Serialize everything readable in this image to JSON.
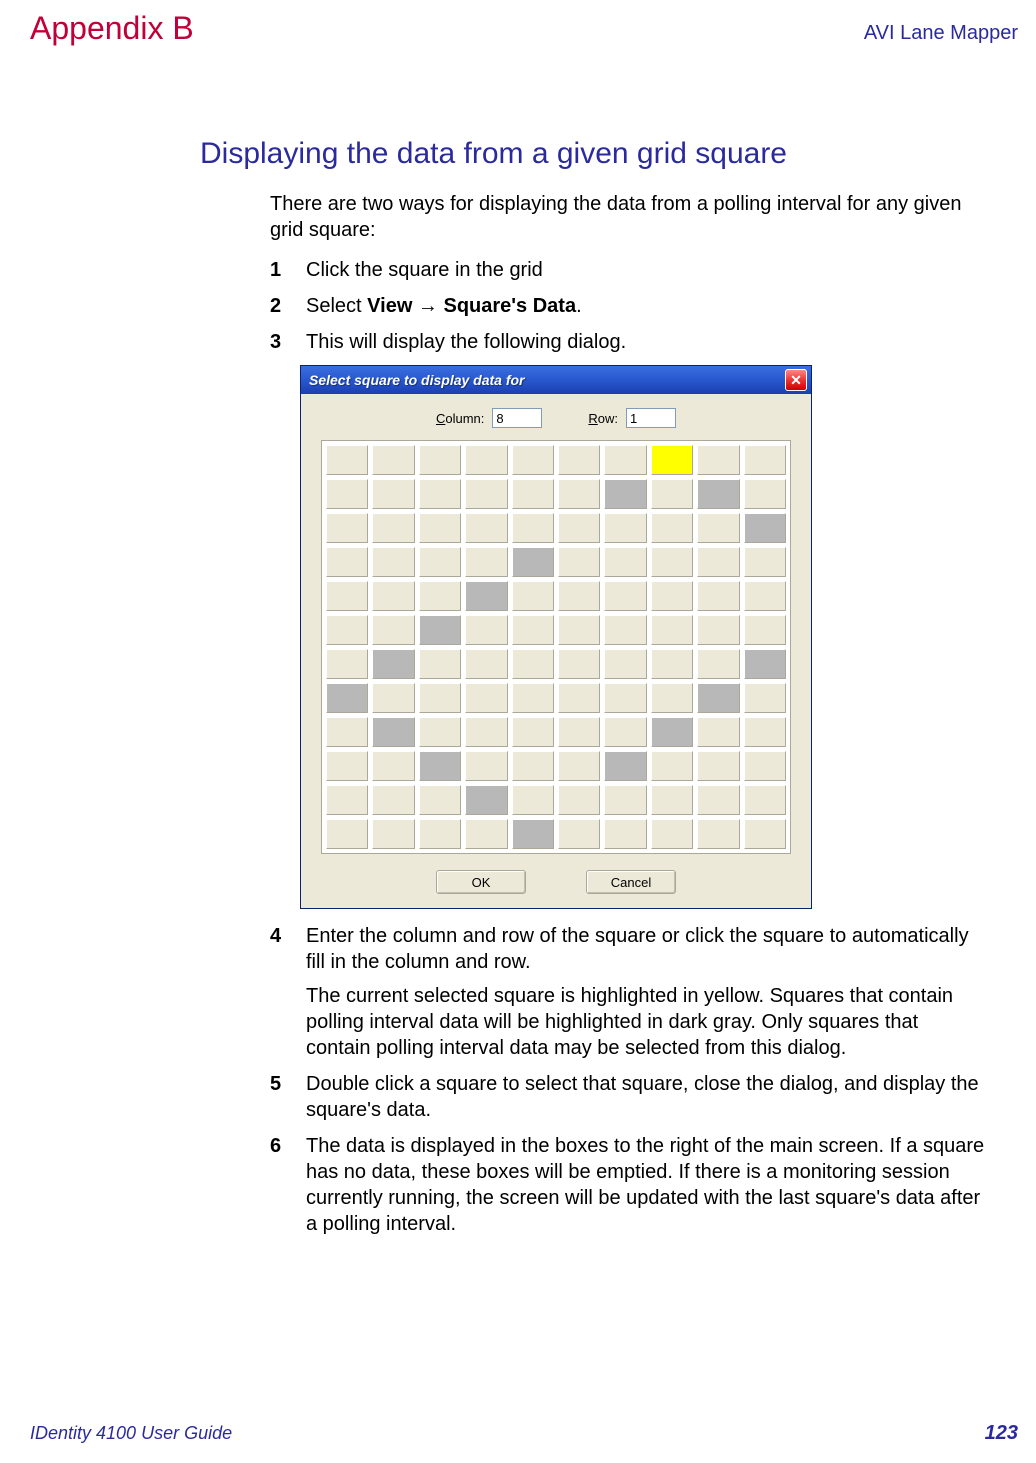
{
  "header": {
    "appendix": "Appendix B",
    "right": "AVI Lane Mapper"
  },
  "section": {
    "heading": "Displaying the data from a given grid square",
    "intro": "There are two ways for displaying the data from a polling interval for any given grid square:"
  },
  "steps": {
    "s1": "Click the square in the grid",
    "s2_pre": "Select ",
    "s2_bold": "View → Square's Data",
    "s2_post": ".",
    "s3": "This will display the following dialog.",
    "s4a": "Enter the column and row of the square or click the square to automatically fill in the column and row.",
    "s4b": "The current selected square is highlighted in yellow. Squares that contain polling interval data will be highlighted in dark gray. Only squares that contain polling interval data may be selected from this dialog.",
    "s5": "Double click a square to select that square, close the dialog, and display the square's data.",
    "s6": "The data is displayed in the boxes to the right of the main screen. If a square has no data, these boxes will be emptied. If there is a monitoring session currently running, the screen will be updated with the last square's data after a polling interval."
  },
  "dialog": {
    "title": "Select square to display data for",
    "column_label_u": "C",
    "column_label_rest": "olumn:",
    "row_label_u": "R",
    "row_label_rest": "ow:",
    "column_value": "8",
    "row_value": "1",
    "ok": "OK",
    "cancel": "Cancel",
    "grid": {
      "rows": 12,
      "cols": 10,
      "selected": [
        0,
        7
      ],
      "data_cells": [
        [
          1,
          6
        ],
        [
          1,
          8
        ],
        [
          2,
          9
        ],
        [
          3,
          4
        ],
        [
          4,
          3
        ],
        [
          5,
          2
        ],
        [
          6,
          1
        ],
        [
          6,
          9
        ],
        [
          7,
          0
        ],
        [
          7,
          8
        ],
        [
          8,
          1
        ],
        [
          8,
          7
        ],
        [
          9,
          2
        ],
        [
          9,
          6
        ],
        [
          10,
          3
        ],
        [
          11,
          4
        ]
      ]
    }
  },
  "footer": {
    "left": "IDentity 4100 User Guide",
    "page": "123"
  }
}
